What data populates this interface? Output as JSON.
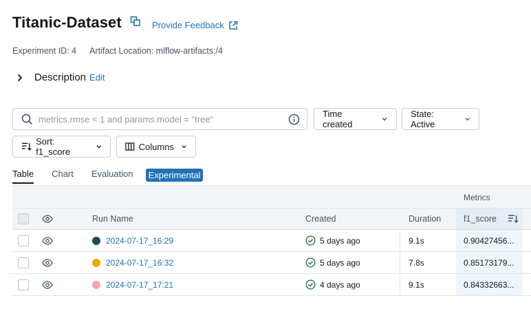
{
  "header": {
    "title": "Titanic-Dataset",
    "feedback_label": "Provide Feedback"
  },
  "meta": {
    "experiment_id": "Experiment ID: 4",
    "artifact_location": "Artifact Location: mlflow-artifacts:/4"
  },
  "description": {
    "label": "Description",
    "edit_label": "Edit"
  },
  "search": {
    "placeholder": "metrics.rmse < 1 and params.model = \"tree\"",
    "value": ""
  },
  "filters": {
    "time_label": "Time created",
    "state_label": "State: Active",
    "sort_label": "Sort: f1_score",
    "columns_label": "Columns"
  },
  "tabs": [
    {
      "label": "Table",
      "active": true
    },
    {
      "label": "Chart",
      "active": false
    },
    {
      "label": "Evaluation",
      "active": false
    },
    {
      "label": "Experimental",
      "active": false
    }
  ],
  "table": {
    "group_header": "Metrics",
    "columns": {
      "run_name": "Run Name",
      "created": "Created",
      "duration": "Duration",
      "metric": "f1_score"
    },
    "rows": [
      {
        "name": "2024-07-17_16:29",
        "color": "#1c4e57",
        "created": "5 days ago",
        "duration": "9.1s",
        "f1_score": "0.90427456..."
      },
      {
        "name": "2024-07-17_16:32",
        "color": "#f5a700",
        "created": "5 days ago",
        "duration": "7.8s",
        "f1_score": "0.85173179..."
      },
      {
        "name": "2024-07-17_17:21",
        "color": "#f4a5a5",
        "created": "4 days ago",
        "duration": "9.1s",
        "f1_score": "0.84332663..."
      }
    ]
  },
  "colors": {
    "link": "#2272b4",
    "success": "#277c43"
  }
}
